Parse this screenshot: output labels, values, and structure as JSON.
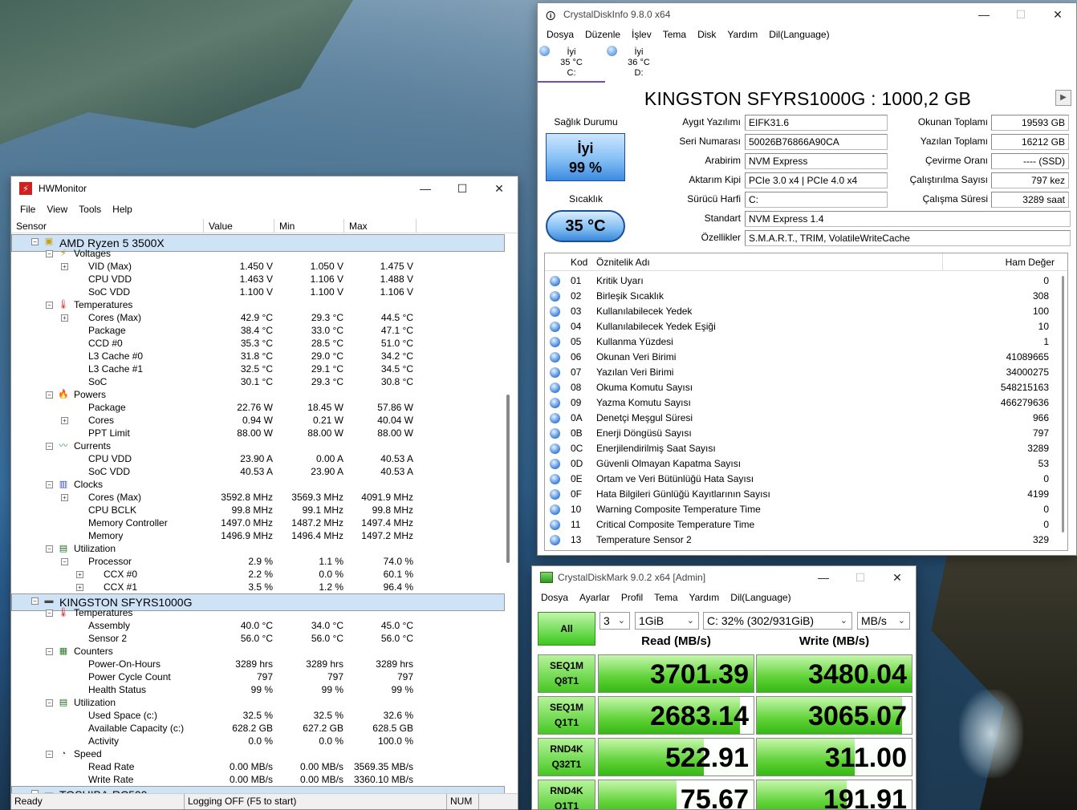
{
  "hwmonitor": {
    "title": "HWMonitor",
    "menu": [
      "File",
      "View",
      "Tools",
      "Help"
    ],
    "columns": [
      "Sensor",
      "Value",
      "Min",
      "Max"
    ],
    "rows": [
      {
        "indent": 1,
        "exp": "−",
        "icon": "cpu-icon",
        "label": "AMD Ryzen 5 3500X",
        "sel": true
      },
      {
        "indent": 2,
        "exp": "−",
        "icon": "voltage-icon",
        "label": "Voltages"
      },
      {
        "indent": 3,
        "exp": "+",
        "label": "VID (Max)",
        "value": "1.450 V",
        "min": "1.050 V",
        "max": "1.475 V"
      },
      {
        "indent": 3,
        "label": "CPU VDD",
        "value": "1.463 V",
        "min": "1.106 V",
        "max": "1.488 V"
      },
      {
        "indent": 3,
        "label": "SoC VDD",
        "value": "1.100 V",
        "min": "1.100 V",
        "max": "1.106 V"
      },
      {
        "indent": 2,
        "exp": "−",
        "icon": "thermometer-icon",
        "label": "Temperatures"
      },
      {
        "indent": 3,
        "exp": "+",
        "label": "Cores (Max)",
        "value": "42.9 °C",
        "min": "29.3 °C",
        "max": "44.5 °C"
      },
      {
        "indent": 3,
        "label": "Package",
        "value": "38.4 °C",
        "min": "33.0 °C",
        "max": "47.1 °C"
      },
      {
        "indent": 3,
        "label": "CCD #0",
        "value": "35.3 °C",
        "min": "28.5 °C",
        "max": "51.0 °C"
      },
      {
        "indent": 3,
        "label": "L3 Cache #0",
        "value": "31.8 °C",
        "min": "29.0 °C",
        "max": "34.2 °C"
      },
      {
        "indent": 3,
        "label": "L3 Cache #1",
        "value": "32.5 °C",
        "min": "29.1 °C",
        "max": "34.5 °C"
      },
      {
        "indent": 3,
        "label": "SoC",
        "value": "30.1 °C",
        "min": "29.3 °C",
        "max": "30.8 °C"
      },
      {
        "indent": 2,
        "exp": "−",
        "icon": "power-icon",
        "label": "Powers"
      },
      {
        "indent": 3,
        "label": "Package",
        "value": "22.76 W",
        "min": "18.45 W",
        "max": "57.86 W"
      },
      {
        "indent": 3,
        "exp": "+",
        "label": "Cores",
        "value": "0.94 W",
        "min": "0.21 W",
        "max": "40.04 W"
      },
      {
        "indent": 3,
        "label": "PPT Limit",
        "value": "88.00 W",
        "min": "88.00 W",
        "max": "88.00 W"
      },
      {
        "indent": 2,
        "exp": "−",
        "icon": "current-icon",
        "label": "Currents"
      },
      {
        "indent": 3,
        "label": "CPU VDD",
        "value": "23.90 A",
        "min": "0.00 A",
        "max": "40.53 A"
      },
      {
        "indent": 3,
        "label": "SoC VDD",
        "value": "40.53 A",
        "min": "23.90 A",
        "max": "40.53 A"
      },
      {
        "indent": 2,
        "exp": "−",
        "icon": "clock-icon",
        "label": "Clocks"
      },
      {
        "indent": 3,
        "exp": "+",
        "label": "Cores (Max)",
        "value": "3592.8 MHz",
        "min": "3569.3 MHz",
        "max": "4091.9 MHz"
      },
      {
        "indent": 3,
        "label": "CPU BCLK",
        "value": "99.8 MHz",
        "min": "99.1 MHz",
        "max": "99.8 MHz"
      },
      {
        "indent": 3,
        "label": "Memory Controller",
        "value": "1497.0 MHz",
        "min": "1487.2 MHz",
        "max": "1497.4 MHz"
      },
      {
        "indent": 3,
        "label": "Memory",
        "value": "1496.9 MHz",
        "min": "1496.4 MHz",
        "max": "1497.2 MHz"
      },
      {
        "indent": 2,
        "exp": "−",
        "icon": "utilization-icon",
        "label": "Utilization"
      },
      {
        "indent": 3,
        "exp": "−",
        "label": "Processor",
        "value": "2.9 %",
        "min": "1.1 %",
        "max": "74.0 %"
      },
      {
        "indent": 4,
        "exp": "+",
        "label": "CCX #0",
        "value": "2.2 %",
        "min": "0.0 %",
        "max": "60.1 %"
      },
      {
        "indent": 4,
        "exp": "+",
        "label": "CCX #1",
        "value": "3.5 %",
        "min": "1.2 %",
        "max": "96.4 %"
      },
      {
        "indent": 1,
        "exp": "−",
        "icon": "drive-icon",
        "label": "KINGSTON SFYRS1000G",
        "sel": true
      },
      {
        "indent": 2,
        "exp": "−",
        "icon": "thermometer-icon",
        "label": "Temperatures"
      },
      {
        "indent": 3,
        "label": "Assembly",
        "value": "40.0 °C",
        "min": "34.0 °C",
        "max": "45.0 °C"
      },
      {
        "indent": 3,
        "label": "Sensor 2",
        "value": "56.0 °C",
        "min": "56.0 °C",
        "max": "56.0 °C"
      },
      {
        "indent": 2,
        "exp": "−",
        "icon": "counters-icon",
        "label": "Counters"
      },
      {
        "indent": 3,
        "label": "Power-On-Hours",
        "value": "3289 hrs",
        "min": "3289 hrs",
        "max": "3289 hrs"
      },
      {
        "indent": 3,
        "label": "Power Cycle Count",
        "value": "797",
        "min": "797",
        "max": "797"
      },
      {
        "indent": 3,
        "label": "Health Status",
        "value": "99 %",
        "min": "99 %",
        "max": "99 %"
      },
      {
        "indent": 2,
        "exp": "−",
        "icon": "utilization-icon",
        "label": "Utilization"
      },
      {
        "indent": 3,
        "label": "Used Space (c:)",
        "value": "32.5 %",
        "min": "32.5 %",
        "max": "32.6 %"
      },
      {
        "indent": 3,
        "label": "Available Capacity (c:)",
        "value": "628.2 GB",
        "min": "627.2 GB",
        "max": "628.5 GB"
      },
      {
        "indent": 3,
        "label": "Activity",
        "value": "0.0 %",
        "min": "0.0 %",
        "max": "100.0 %"
      },
      {
        "indent": 2,
        "exp": "−",
        "icon": "speed-icon",
        "label": "Speed"
      },
      {
        "indent": 3,
        "label": "Read Rate",
        "value": "0.00 MB/s",
        "min": "0.00 MB/s",
        "max": "3569.35 MB/s"
      },
      {
        "indent": 3,
        "label": "Write Rate",
        "value": "0.00 MB/s",
        "min": "0.00 MB/s",
        "max": "3360.10 MB/s"
      },
      {
        "indent": 1,
        "exp": "−",
        "icon": "drive-icon",
        "label": "TOSHIBA-RC500",
        "sel": true
      }
    ],
    "status": [
      "Ready",
      "Logging OFF (F5 to start)",
      "NUM"
    ]
  },
  "cdi": {
    "title": "CrystalDiskInfo 9.8.0 x64",
    "menu": [
      "Dosya",
      "Düzenle",
      "İşlev",
      "Tema",
      "Disk",
      "Yardım",
      "Dil(Language)"
    ],
    "drives": [
      {
        "status": "İyi",
        "temp": "35 °C",
        "letter": "C:"
      },
      {
        "status": "İyi",
        "temp": "36 °C",
        "letter": "D:"
      }
    ],
    "model": "KINGSTON SFYRS1000G : 1000,2 GB",
    "health_label": "Sağlık Durumu",
    "health_status": "İyi",
    "health_pct": "99 %",
    "temp_label": "Sıcaklık",
    "temp": "35 °C",
    "info_left": [
      {
        "label": "Aygıt Yazılımı",
        "value": "EIFK31.6"
      },
      {
        "label": "Seri Numarası",
        "value": "50026B76866A90CA"
      },
      {
        "label": "Arabirim",
        "value": "NVM Express"
      },
      {
        "label": "Aktarım Kipi",
        "value": "PCIe 3.0 x4 | PCIe 4.0 x4"
      },
      {
        "label": "Sürücü Harfi",
        "value": "C:"
      }
    ],
    "info_right": [
      {
        "label": "Okunan Toplamı",
        "value": "19593 GB"
      },
      {
        "label": "Yazılan Toplamı",
        "value": "16212 GB"
      },
      {
        "label": "Çevirme Oranı",
        "value": "---- (SSD)"
      },
      {
        "label": "Çalıştırılma Sayısı",
        "value": "797 kez"
      },
      {
        "label": "Çalışma Süresi",
        "value": "3289 saat"
      }
    ],
    "standard_label": "Standart",
    "standard": "NVM Express 1.4",
    "features_label": "Özellikler",
    "features": "S.M.A.R.T., TRIM, VolatileWriteCache",
    "attr_headers": [
      "Kod",
      "Öznitelik Adı",
      "Ham Değer"
    ],
    "attributes": [
      {
        "kod": "01",
        "name": "Kritik Uyarı",
        "raw": "0"
      },
      {
        "kod": "02",
        "name": "Birleşik Sıcaklık",
        "raw": "308"
      },
      {
        "kod": "03",
        "name": "Kullanılabilecek Yedek",
        "raw": "100"
      },
      {
        "kod": "04",
        "name": "Kullanılabilecek Yedek Eşiği",
        "raw": "10"
      },
      {
        "kod": "05",
        "name": "Kullanma Yüzdesi",
        "raw": "1"
      },
      {
        "kod": "06",
        "name": "Okunan Veri Birimi",
        "raw": "41089665"
      },
      {
        "kod": "07",
        "name": "Yazılan Veri Birimi",
        "raw": "34000275"
      },
      {
        "kod": "08",
        "name": "Okuma Komutu Sayısı",
        "raw": "548215163"
      },
      {
        "kod": "09",
        "name": "Yazma Komutu Sayısı",
        "raw": "466279636"
      },
      {
        "kod": "0A",
        "name": "Denetçi Meşgul Süresi",
        "raw": "966"
      },
      {
        "kod": "0B",
        "name": "Enerji Döngüsü Sayısı",
        "raw": "797"
      },
      {
        "kod": "0C",
        "name": "Enerjilendirilmiş Saat Sayısı",
        "raw": "3289"
      },
      {
        "kod": "0D",
        "name": "Güvenli Olmayan Kapatma Sayısı",
        "raw": "53"
      },
      {
        "kod": "0E",
        "name": "Ortam ve Veri Bütünlüğü Hata Sayısı",
        "raw": "0"
      },
      {
        "kod": "0F",
        "name": "Hata Bilgileri Günlüğü Kayıtlarının Sayısı",
        "raw": "4199"
      },
      {
        "kod": "10",
        "name": "Warning Composite Temperature Time",
        "raw": "0"
      },
      {
        "kod": "11",
        "name": "Critical Composite Temperature Time",
        "raw": "0"
      },
      {
        "kod": "13",
        "name": "Temperature Sensor 2",
        "raw": "329"
      }
    ]
  },
  "cdm": {
    "title": "CrystalDiskMark 9.0.2 x64 [Admin]",
    "menu": [
      "Dosya",
      "Ayarlar",
      "Profil",
      "Tema",
      "Yardım",
      "Dil(Language)"
    ],
    "all_label": "All",
    "count": "3",
    "size": "1GiB",
    "drive": "C: 32% (302/931GiB)",
    "unit": "MB/s",
    "read_header": "Read (MB/s)",
    "write_header": "Write (MB/s)",
    "tests": [
      {
        "l1": "SEQ1M",
        "l2": "Q8T1",
        "read": "3701.39",
        "write": "3480.04",
        "read_fill": 1.0,
        "write_fill": 1.0
      },
      {
        "l1": "SEQ1M",
        "l2": "Q1T1",
        "read": "2683.14",
        "write": "3065.07",
        "read_fill": 0.91,
        "write_fill": 0.94
      },
      {
        "l1": "RND4K",
        "l2": "Q32T1",
        "read": "522.91",
        "write": "311.00",
        "read_fill": 0.68,
        "write_fill": 0.63
      },
      {
        "l1": "RND4K",
        "l2": "Q1T1",
        "read": "75.67",
        "write": "191.91",
        "read_fill": 0.5,
        "write_fill": 0.58
      }
    ]
  }
}
